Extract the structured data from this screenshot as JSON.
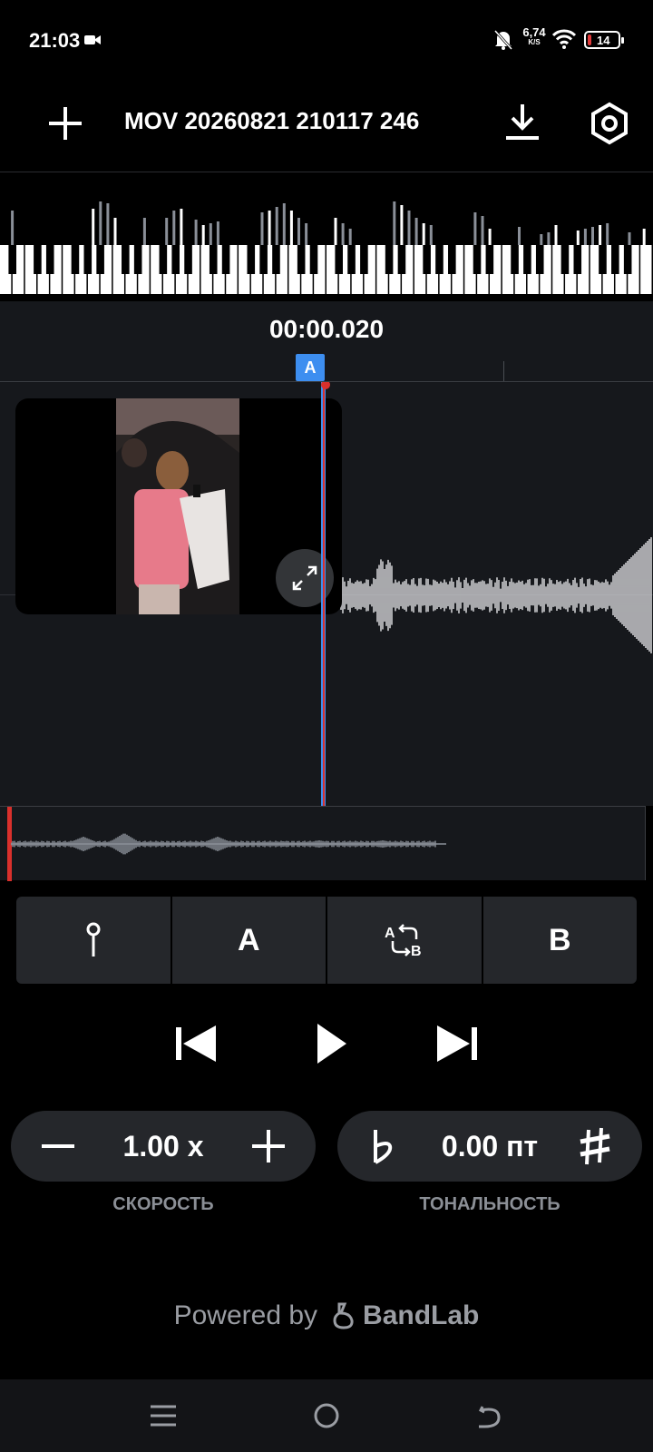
{
  "status_bar": {
    "time": "21:03",
    "net_speed": "6,74",
    "net_unit": "K/S",
    "battery": "14",
    "icons": [
      "video-camera-icon",
      "bell-off-icon",
      "wifi-icon",
      "battery-icon"
    ]
  },
  "toolbar": {
    "title": "MOV 20260821 210117 246",
    "icons": [
      "plus-icon",
      "download-icon",
      "settings-hexagon-icon"
    ]
  },
  "timeline": {
    "timecode": "00:00.020",
    "marker_label": "A"
  },
  "loop_controls": {
    "pin_icon": "pin-icon",
    "a_label": "A",
    "ab_icon": "ab-loop-icon",
    "b_label": "B"
  },
  "transport": {
    "icons": [
      "skip-previous-icon",
      "play-icon",
      "skip-next-icon"
    ]
  },
  "speed": {
    "value": "1.00 x",
    "label": "СКОРОСТЬ"
  },
  "pitch": {
    "value": "0.00 пт",
    "label": "ТОНАЛЬНОСТЬ"
  },
  "footer": {
    "powered_by": "Powered by",
    "brand": "BandLab"
  },
  "colors": {
    "accent": "#3d8ef0",
    "playhead_red": "#d9302c",
    "panel": "#25272b",
    "track_bg": "#16181c"
  }
}
